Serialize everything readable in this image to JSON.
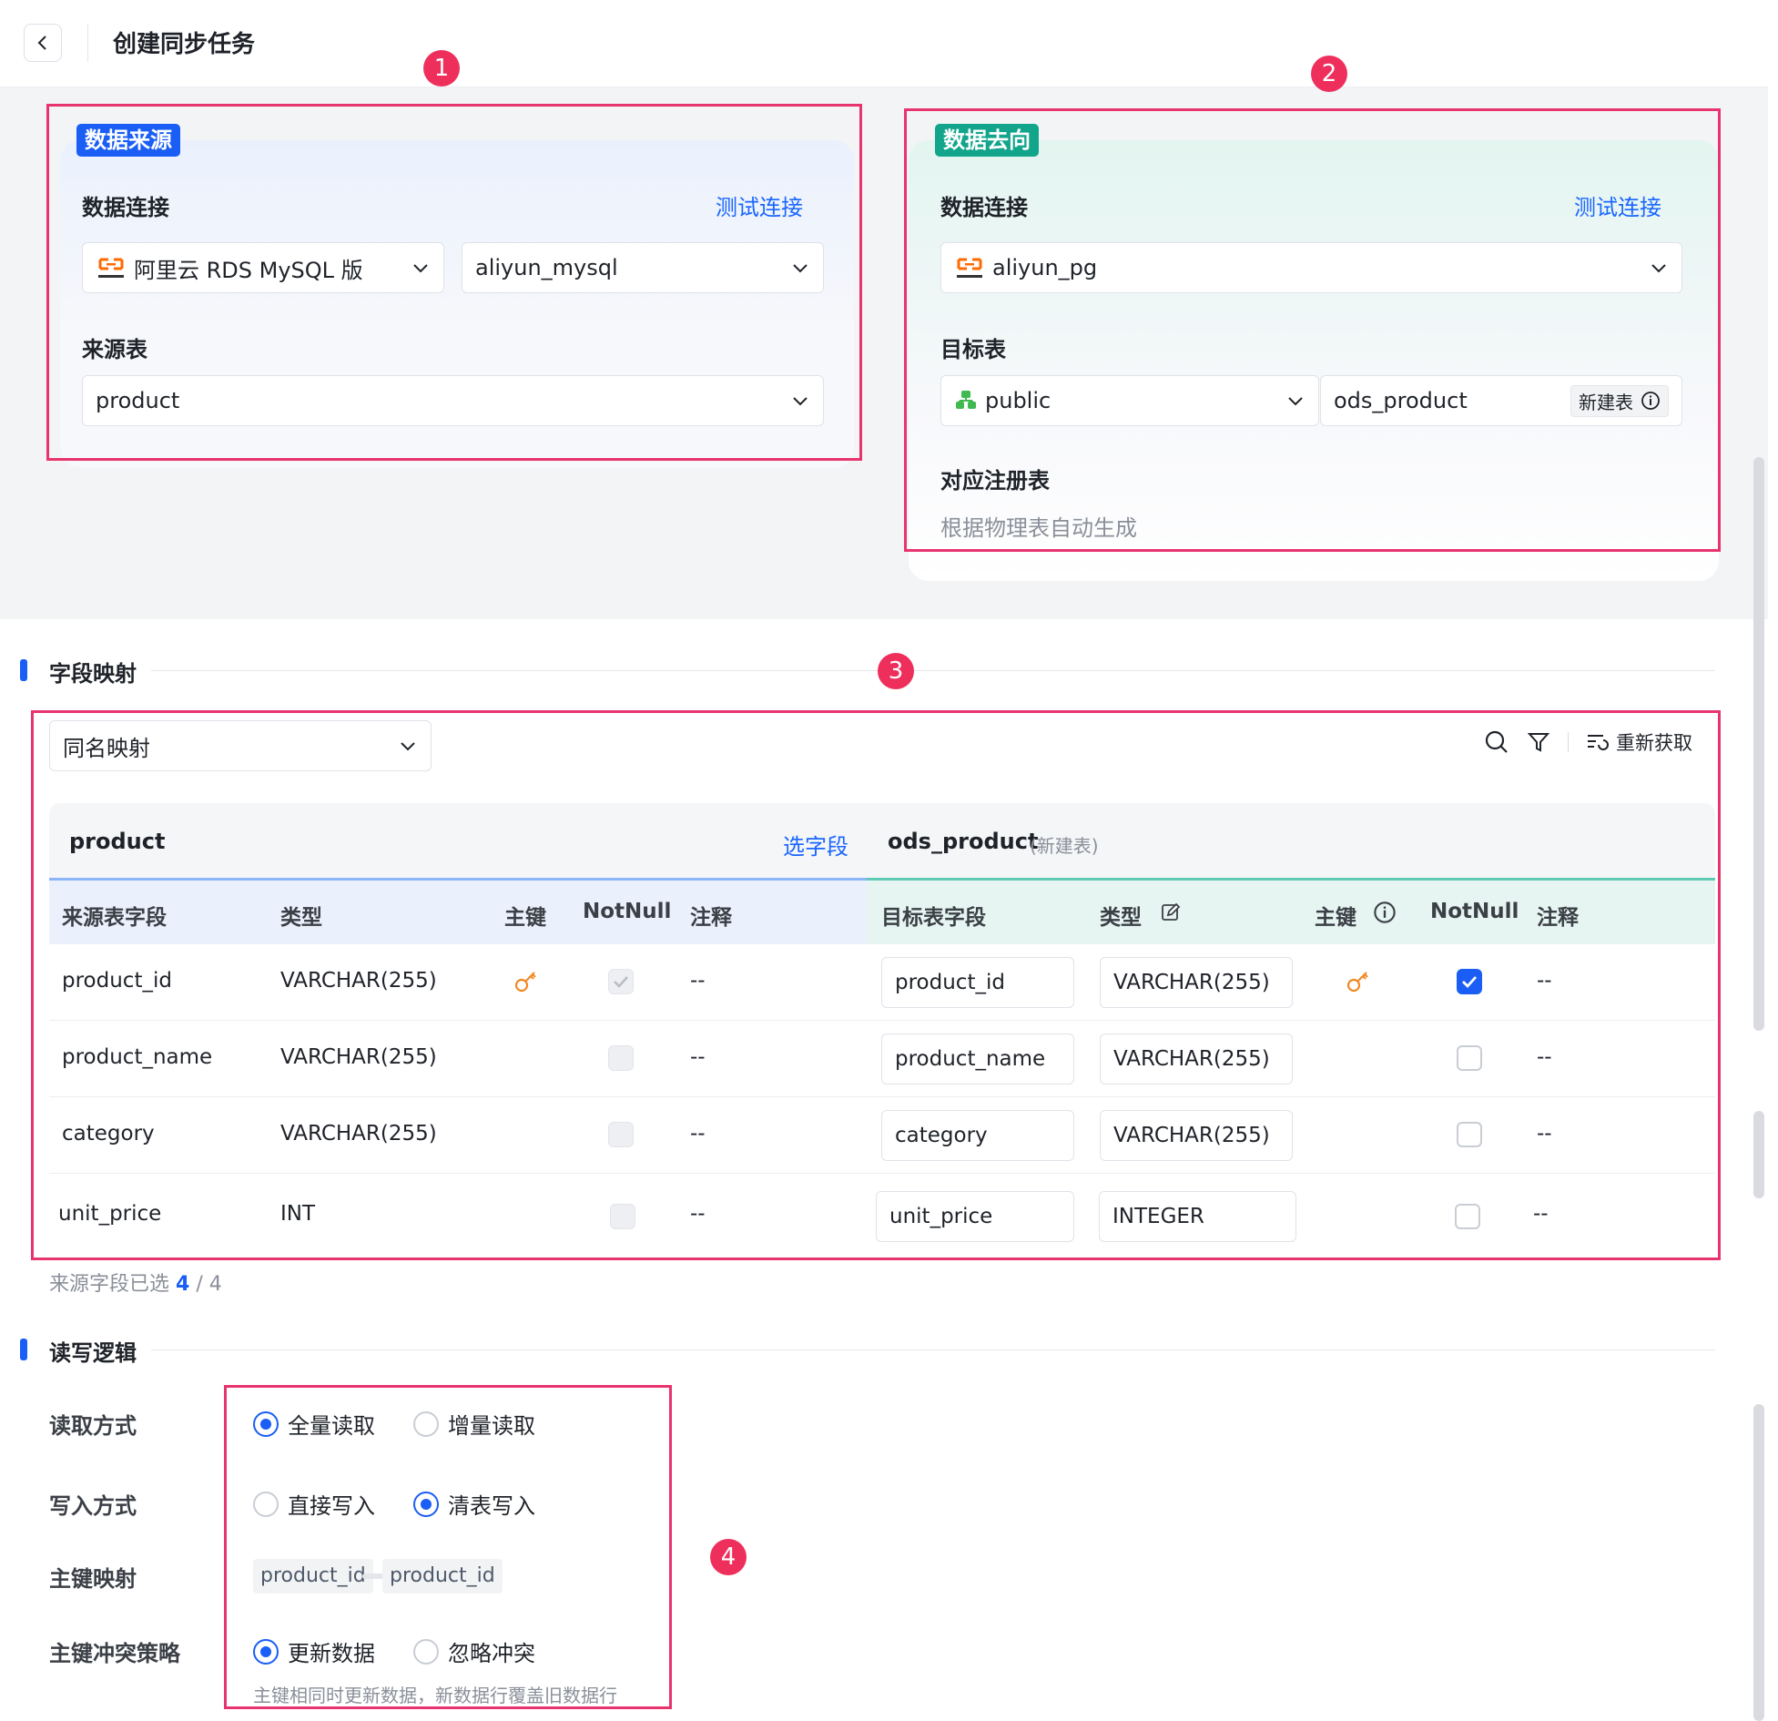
{
  "header": {
    "title": "创建同步任务"
  },
  "badges": [
    "1",
    "2",
    "3",
    "4"
  ],
  "source": {
    "tag": "数据来源",
    "connection_label": "数据连接",
    "test_link": "测试连接",
    "db_type": "阿里云 RDS MySQL 版",
    "connection": "aliyun_mysql",
    "table_label": "来源表",
    "table": "product"
  },
  "target": {
    "tag": "数据去向",
    "connection_label": "数据连接",
    "test_link": "测试连接",
    "connection": "aliyun_pg",
    "table_label": "目标表",
    "schema": "public",
    "table": "ods_product",
    "new_table_btn": "新建表",
    "registry_label": "对应注册表",
    "registry_hint": "根据物理表自动生成"
  },
  "mapping": {
    "section_title": "字段映射",
    "mode": "同名映射",
    "refetch": "重新获取",
    "source_table": "product",
    "select_fields": "选字段",
    "target_table": "ods_product",
    "target_suffix": "(新建表)",
    "source_headers": [
      "来源表字段",
      "类型",
      "主键",
      "NotNull",
      "注释"
    ],
    "target_headers": [
      "目标表字段",
      "类型",
      "主键",
      "NotNull",
      "注释"
    ],
    "rows": [
      {
        "src_field": "product_id",
        "src_type": "VARCHAR(255)",
        "src_pk": true,
        "src_notnull": true,
        "src_comment": "--",
        "dst_field": "product_id",
        "dst_type": "VARCHAR(255)",
        "dst_pk": true,
        "dst_notnull": true,
        "dst_comment": "--"
      },
      {
        "src_field": "product_name",
        "src_type": "VARCHAR(255)",
        "src_pk": false,
        "src_notnull": false,
        "src_comment": "--",
        "dst_field": "product_name",
        "dst_type": "VARCHAR(255)",
        "dst_pk": false,
        "dst_notnull": false,
        "dst_comment": "--"
      },
      {
        "src_field": "category",
        "src_type": "VARCHAR(255)",
        "src_pk": false,
        "src_notnull": false,
        "src_comment": "--",
        "dst_field": "category",
        "dst_type": "VARCHAR(255)",
        "dst_pk": false,
        "dst_notnull": false,
        "dst_comment": "--"
      },
      {
        "src_field": "unit_price",
        "src_type": "INT",
        "src_pk": false,
        "src_notnull": false,
        "src_comment": "--",
        "dst_field": "unit_price",
        "dst_type": "INTEGER",
        "dst_pk": false,
        "dst_notnull": false,
        "dst_comment": "--"
      }
    ],
    "count_prefix": "来源字段已选",
    "count_selected": "4",
    "count_total": "/ 4"
  },
  "rw": {
    "section_title": "读写逻辑",
    "read_label": "读取方式",
    "read_options": [
      "全量读取",
      "增量读取"
    ],
    "read_selected": "全量读取",
    "write_label": "写入方式",
    "write_options": [
      "直接写入",
      "清表写入"
    ],
    "write_selected": "清表写入",
    "pk_label": "主键映射",
    "pk_source": "product_id",
    "pk_target": "product_id",
    "conflict_label": "主键冲突策略",
    "conflict_options": [
      "更新数据",
      "忽略冲突"
    ],
    "conflict_selected": "更新数据",
    "conflict_hint": "主键相同时更新数据，新数据行覆盖旧数据行"
  },
  "colors": {
    "accent": "#1a5ef5",
    "source_tag": "#1a5ef5",
    "target_tag": "#12a58c",
    "highlight": "#e8346e",
    "key": "#f08a24"
  }
}
